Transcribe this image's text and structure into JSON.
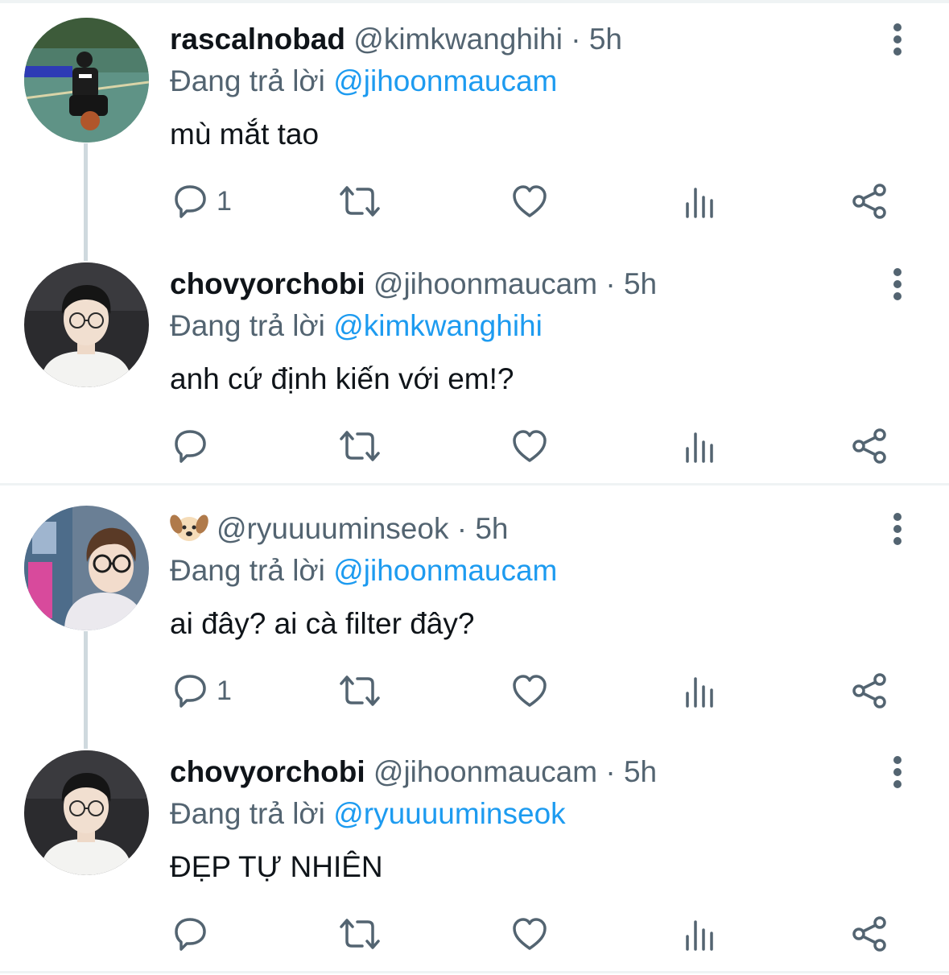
{
  "reply_prefix": "Đang trả lời",
  "tweets": [
    {
      "display_name": "rascalnobad",
      "handle": "@kimkwanghihi",
      "dot": "·",
      "time": "5h",
      "reply_to": "@jihoonmaucam",
      "text": "mù mắt tao",
      "reply_count": "1",
      "avatar": "avatar-basketball-court"
    },
    {
      "display_name": "chovyorchobi",
      "handle": "@jihoonmaucam",
      "dot": "·",
      "time": "5h",
      "reply_to": "@kimkwanghihi",
      "text": "anh cứ định kiến với em!?",
      "reply_count": "",
      "avatar": "avatar-glasses-white-shirt"
    },
    {
      "display_name_icon": "dog-face-emoji",
      "handle": "@ryuuuuminseok",
      "dot": "·",
      "time": "5h",
      "reply_to": "@jihoonmaucam",
      "text": "ai đây? ai cà filter đây?",
      "reply_count": "1",
      "avatar": "avatar-glasses-hoodie"
    },
    {
      "display_name": "chovyorchobi",
      "handle": "@jihoonmaucam",
      "dot": "·",
      "time": "5h",
      "reply_to": "@ryuuuuminseok",
      "text": "ĐẸP TỰ NHIÊN",
      "reply_count": "",
      "avatar": "avatar-glasses-white-shirt"
    }
  ],
  "icons": {
    "reply": "reply-icon",
    "retweet": "retweet-icon",
    "like": "like-icon",
    "views": "views-icon",
    "share": "share-icon",
    "more": "more-icon"
  },
  "colors": {
    "text": "#0f1419",
    "secondary": "#536471",
    "mention": "#1d9bf0",
    "separator": "#eff3f4",
    "thread_line": "#cfd9de"
  }
}
